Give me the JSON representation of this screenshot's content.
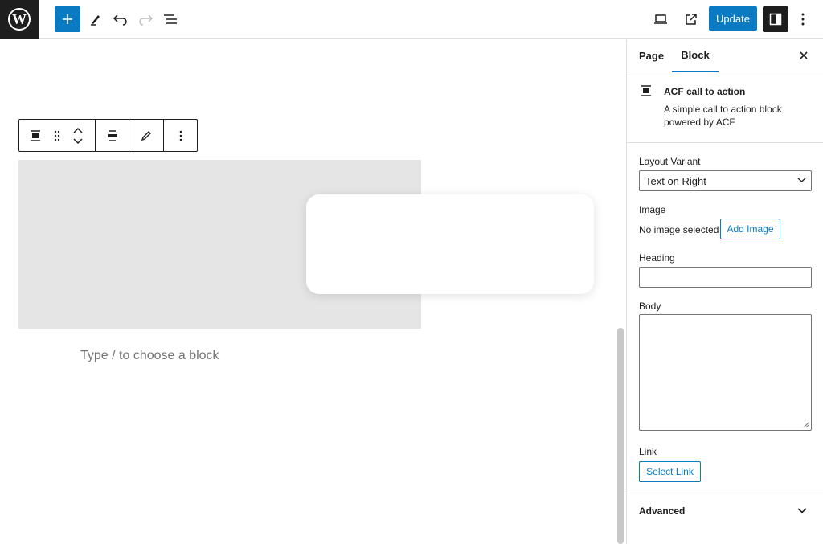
{
  "header": {
    "update_label": "Update",
    "icons": [
      "wordpress-logo",
      "add-block-icon",
      "tools-icon",
      "undo-icon",
      "redo-icon",
      "list-view-icon",
      "preview-icon",
      "view-post-icon",
      "settings-icon",
      "options-icon"
    ]
  },
  "canvas": {
    "block_hint": "Type / to choose a block"
  },
  "sidebar": {
    "tabs": [
      {
        "label": "Page"
      },
      {
        "label": "Block"
      }
    ],
    "block": {
      "title": "ACF call to action",
      "description": "A simple call to action block powered by ACF"
    },
    "fields": {
      "layout_label": "Layout Variant",
      "layout_value": "Text on Right",
      "image_label": "Image",
      "no_image_text": "No image selected",
      "add_image_label": "Add Image",
      "heading_label": "Heading",
      "body_label": "Body",
      "link_label": "Link",
      "select_link_label": "Select Link"
    },
    "advanced_label": "Advanced"
  },
  "colors": {
    "accent": "#0a7bc2",
    "dark": "#1e1e1e",
    "placeholder": "#e5e5e5"
  }
}
